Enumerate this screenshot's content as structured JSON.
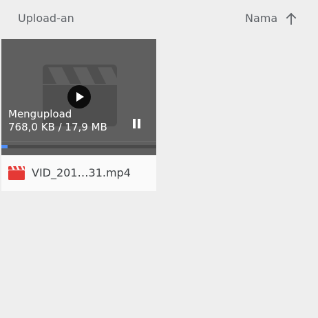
{
  "header": {
    "title": "Upload-an",
    "sort": {
      "label": "Nama",
      "direction_icon": "arrow-up-icon"
    }
  },
  "upload_card": {
    "thumbnail_icon": "video-clapperboard-icon",
    "play_icon": "play-icon",
    "status": "Mengupload",
    "progress_text": "768,0 KB / 17,9 MB",
    "progress_fraction": 0.042,
    "pause_icon": "pause-icon",
    "file_icon": "video-file-icon",
    "file_name": "VID_201…31.mp4"
  },
  "colors": {
    "background": "#eeeeee",
    "thumbnail": "#5f5f5f",
    "progress": "#4f8ef7",
    "video_icon": "#e53935"
  }
}
